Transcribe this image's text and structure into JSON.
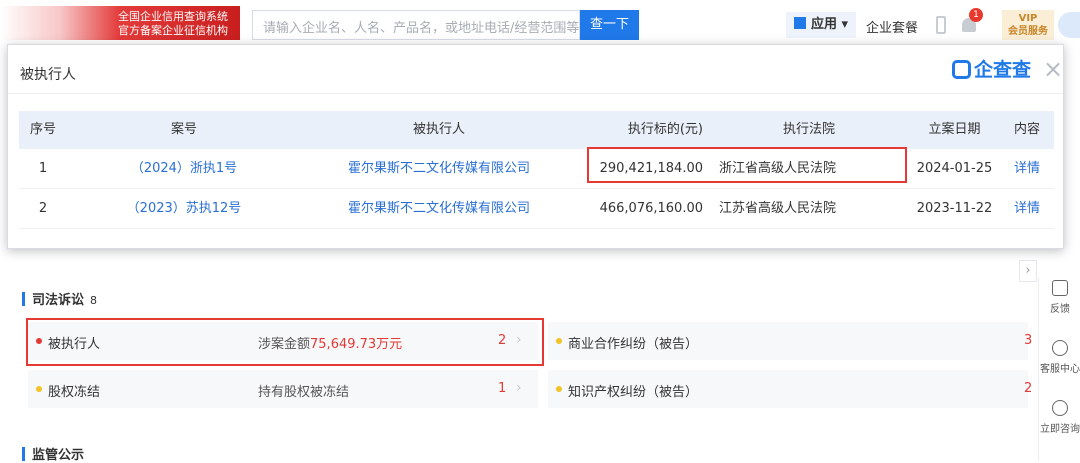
{
  "header": {
    "logo_line1": "全国企业信用查询系统",
    "logo_line2": "官方备案企业征信机构",
    "search_placeholder": "请输入企业名、人名、产品名，或地址电话/经营范围等",
    "search_button": "查一下",
    "apps_label": "应用",
    "package_label": "企业套餐",
    "notification_count": "1",
    "vip_label": "VIP",
    "vip_sub": "会员服务"
  },
  "modal": {
    "title": "被执行人",
    "brand": "企查查",
    "close": "×",
    "columns": [
      "序号",
      "案号",
      "被执行人",
      "执行标的(元)",
      "执行法院",
      "立案日期",
      "内容"
    ],
    "rows": [
      {
        "no": "1",
        "case": "（2024）浙执1号",
        "party": "霍尔果斯不二文化传媒有限公司",
        "amount": "290,421,184.00",
        "court": "浙江省高级人民法院",
        "date": "2024-01-25",
        "detail": "详情"
      },
      {
        "no": "2",
        "case": "（2023）苏执12号",
        "party": "霍尔果斯不二文化传媒有限公司",
        "amount": "466,076,160.00",
        "court": "江苏省高级人民法院",
        "date": "2023-11-22",
        "detail": "详情"
      }
    ]
  },
  "judicial": {
    "title": "司法诉讼",
    "count": "8",
    "items": [
      {
        "label": "被执行人",
        "desc_prefix": "涉案金额",
        "amount": "75,649.73万元",
        "count": "2"
      },
      {
        "label": "股权冻结",
        "desc": "持有股权被冻结",
        "count": "1"
      },
      {
        "label": "商业合作纠纷（被告）",
        "count": "3"
      },
      {
        "label": "知识产权纠纷（被告）",
        "count": "2"
      }
    ]
  },
  "regulatory": {
    "title": "监管公示"
  },
  "sidebar": {
    "collapse": "›",
    "feedback": "反馈",
    "service": "客服中心",
    "consult": "立即咨询"
  },
  "colors": {
    "accent": "#1f79e8",
    "highlight": "#e53935"
  }
}
